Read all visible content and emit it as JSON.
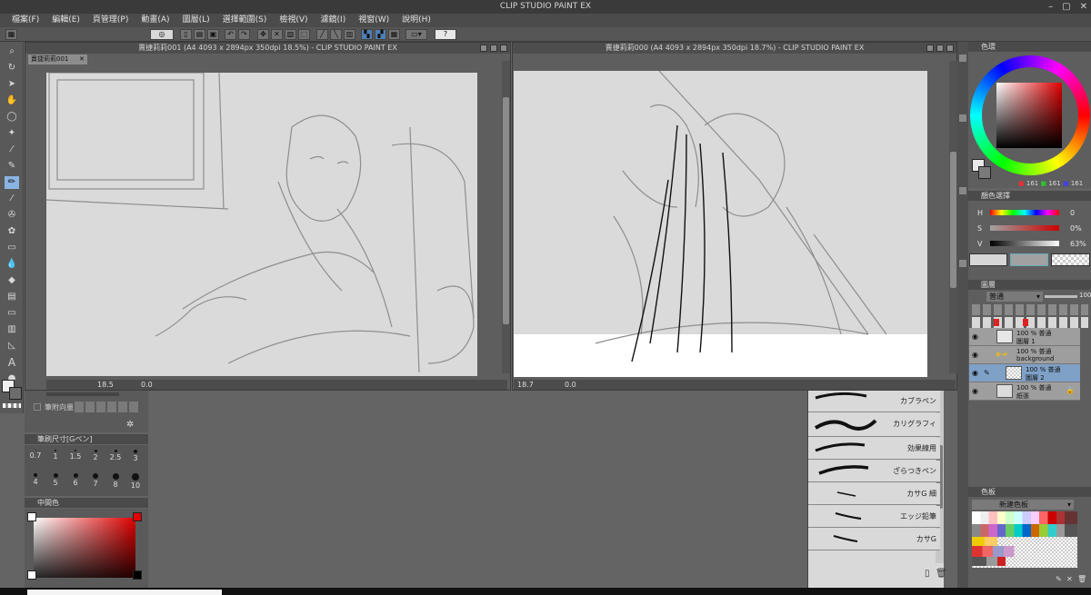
{
  "app": {
    "title": "CLIP STUDIO PAINT EX"
  },
  "menu": [
    "檔案(F)",
    "編輯(E)",
    "頁管理(P)",
    "動畫(A)",
    "圖層(L)",
    "選擇範圍(S)",
    "檢視(V)",
    "濾鏡(I)",
    "視窗(W)",
    "說明(H)"
  ],
  "doc1": {
    "title": "賣捷莉莉001 (A4 4093 x 2894px 350dpi 18.5%) - CLIP STUDIO PAINT EX",
    "tab": "賣捷莉莉001",
    "zoom": "18.5",
    "angle": "0.0"
  },
  "doc2": {
    "title": "賣捷莉莉000 (A4 4093 x 2894px 350dpi 18.7%) - CLIP STUDIO PAINT EX",
    "zoom": "18.7",
    "angle": "0.0"
  },
  "left": {
    "strength": "筆附向量",
    "brushsize_title": "筆刷尺寸[Gペン]",
    "sizes": [
      "0.7",
      "1",
      "1.5",
      "2",
      "2.5",
      "3",
      "4",
      "5",
      "6",
      "7",
      "8",
      "10"
    ],
    "midcolor_title": "中間色"
  },
  "brushes": [
    "カブラペン",
    "カリグラフィ",
    "効果線用",
    "ざらつきペン",
    "カサG 細",
    "エッジ鉛筆",
    "カサG"
  ],
  "color": {
    "title": "色環",
    "r": "161",
    "g": "161",
    "b": "161"
  },
  "colorset": {
    "title": "顏色選擇",
    "h_label": "H",
    "h": "0",
    "s_label": "S",
    "s": "0%",
    "v_label": "V",
    "v": "63%"
  },
  "layers": {
    "title": "圖層",
    "blend": "普通",
    "opacity": "100",
    "items": [
      {
        "l1": "100 % 普通",
        "l2": "圖層 1"
      },
      {
        "l1": "100 % 普通",
        "l2": "background"
      },
      {
        "l1": "100 % 普通",
        "l2": "圖層 2"
      },
      {
        "l1": "100 % 普通",
        "l2": "紙張"
      }
    ]
  },
  "palette": {
    "title": "色板",
    "name": "新建色板"
  },
  "colors": {
    "accent": "#3a7fd0",
    "canvas": "#dadada",
    "panel": "#5e5e5e"
  }
}
